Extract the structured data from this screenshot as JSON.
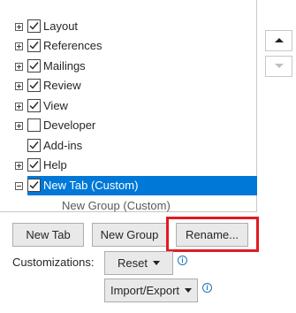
{
  "tree": {
    "items": [
      {
        "label": "Layout",
        "expander": "plus",
        "checked": true
      },
      {
        "label": "References",
        "expander": "plus",
        "checked": true
      },
      {
        "label": "Mailings",
        "expander": "plus",
        "checked": true
      },
      {
        "label": "Review",
        "expander": "plus",
        "checked": true
      },
      {
        "label": "View",
        "expander": "plus",
        "checked": true
      },
      {
        "label": "Developer",
        "expander": "plus",
        "checked": false
      },
      {
        "label": "Add-ins",
        "expander": "none",
        "checked": true
      },
      {
        "label": "Help",
        "expander": "plus",
        "checked": true
      },
      {
        "label": "New Tab (Custom)",
        "expander": "minus",
        "checked": true,
        "selected": true
      }
    ],
    "child_label": "New Group (Custom)"
  },
  "scroll": {
    "up_icon": "arrow-up-icon",
    "down_icon": "arrow-down-icon"
  },
  "buttons": {
    "new_tab": "New Tab",
    "new_group": "New Group",
    "rename": "Rename...",
    "reset": "Reset",
    "import_export": "Import/Export"
  },
  "customizations_label": "Customizations:",
  "info_glyph": "i",
  "colors": {
    "selection": "#0078d7",
    "highlight": "#e01a22",
    "info": "#1e73be"
  }
}
